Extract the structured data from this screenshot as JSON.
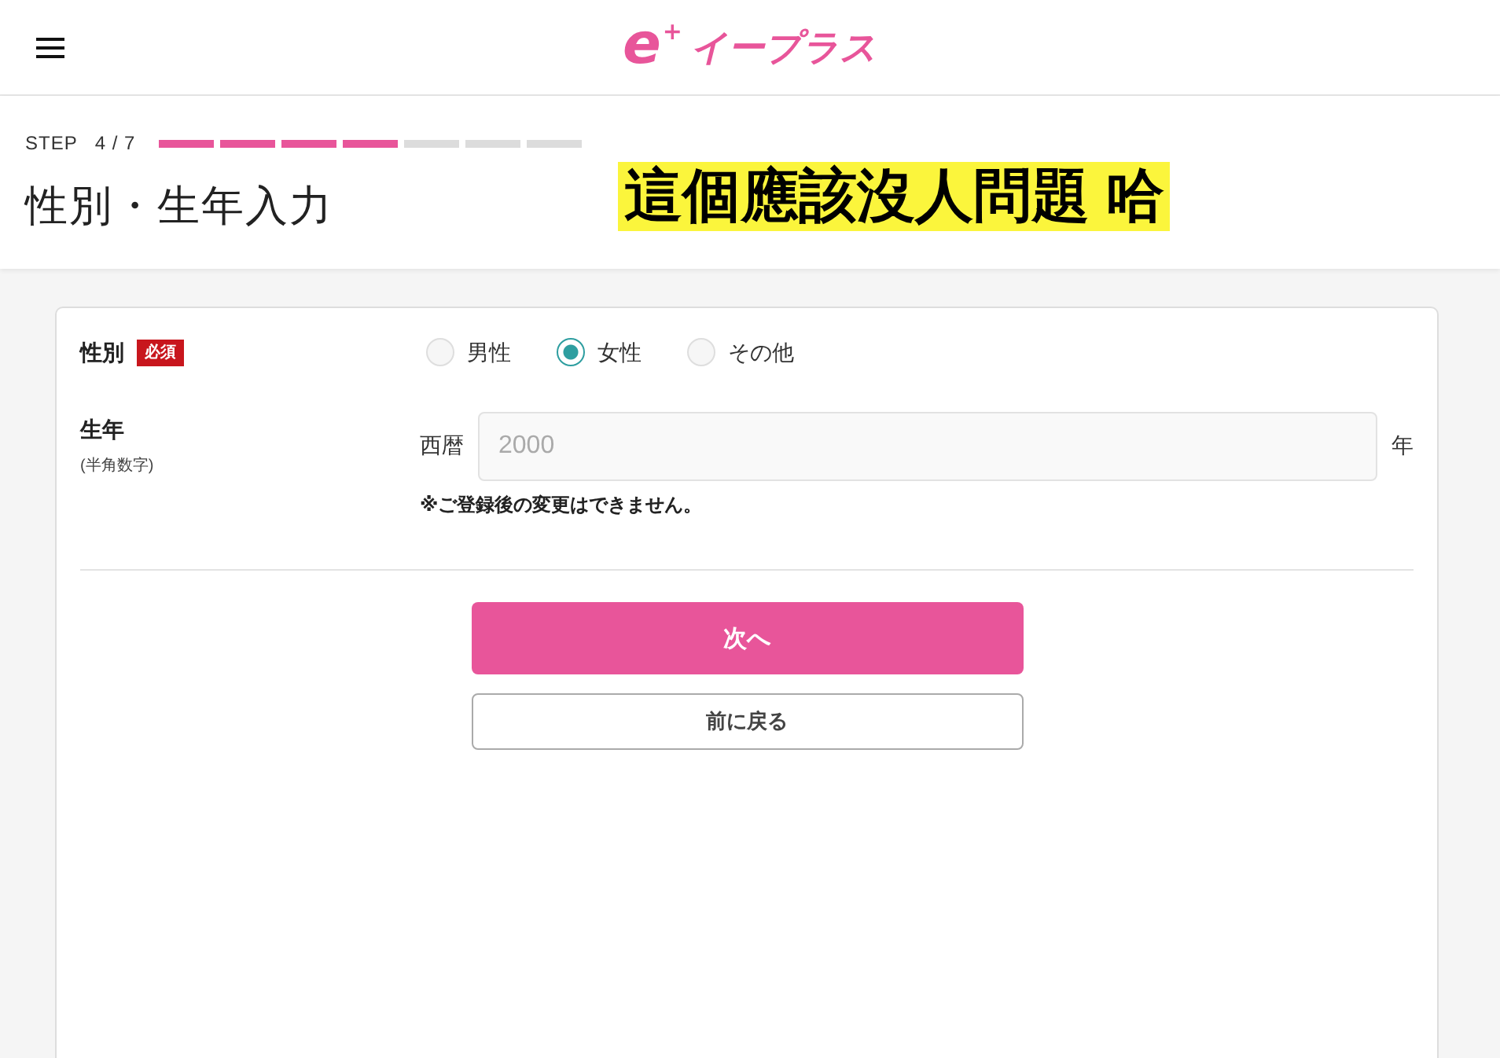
{
  "header": {
    "logo": {
      "mark": "e$^{+}$",
      "name": "イープラス"
    }
  },
  "step": {
    "label": "STEP",
    "count": "4 / 7",
    "segments": [
      {
        "done": true
      },
      {
        "done": true
      },
      {
        "done": true
      },
      {
        "done": true
      },
      {
        "done": false
      },
      {
        "done": false
      },
      {
        "done": false
      }
    ]
  },
  "page_title": "性別・生年入力",
  "annotation": "這個應該沒人問題 哈",
  "form": {
    "gender": {
      "label": "性別",
      "badge": "必須",
      "options": [
        {
          "label": "男性",
          "selected": false
        },
        {
          "label": "女性",
          "selected": true
        },
        {
          "label": "その他",
          "selected": false
        }
      ]
    },
    "birth_year": {
      "label": "生年",
      "hint": "(半角数字)",
      "prefix": "西暦",
      "placeholder": "2000",
      "suffix": "年",
      "note": "※ご登録後の変更はできません。"
    }
  },
  "buttons": [
    {
      "kind": "primary",
      "label": "次へ"
    },
    {
      "kind": "secondary",
      "label": "前に戻る"
    }
  ]
}
